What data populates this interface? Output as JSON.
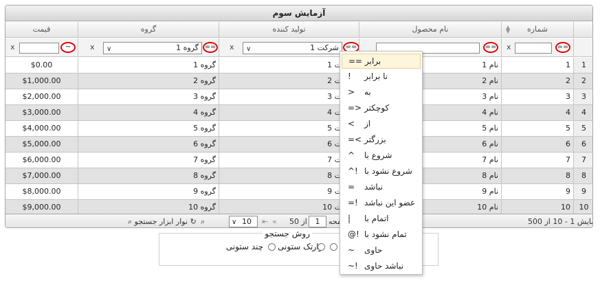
{
  "grid": {
    "caption": "آزمایش سوم",
    "columns": {
      "price": "قیمت",
      "group": "گروه",
      "manufacturer": "تولید کننده",
      "product_name": "نام محصول",
      "number": "شماره"
    },
    "filters": {
      "clear": "x",
      "price_op": "~",
      "group_op": "==",
      "group_value": "گروه 1",
      "manufacturer_op": "==",
      "manufacturer_value": "شرکت 1",
      "product_op": "==",
      "number_op": "=="
    },
    "rows": [
      {
        "price": "$0.00",
        "group": "گروه 1",
        "manufacturer": "شرکت 1",
        "product": "نام 1",
        "number": "1",
        "rownum": "1"
      },
      {
        "price": "$1,000.00",
        "group": "گروه 2",
        "manufacturer": "شرکت 2",
        "product": "نام 2",
        "number": "2",
        "rownum": "2"
      },
      {
        "price": "$2,000.00",
        "group": "گروه 3",
        "manufacturer": "شرکت 3",
        "product": "نام 3",
        "number": "3",
        "rownum": "3"
      },
      {
        "price": "$3,000.00",
        "group": "گروه 4",
        "manufacturer": "شرکت 4",
        "product": "نام 4",
        "number": "4",
        "rownum": "4"
      },
      {
        "price": "$4,000.00",
        "group": "گروه 5",
        "manufacturer": "شرکت 5",
        "product": "نام 5",
        "number": "5",
        "rownum": "5"
      },
      {
        "price": "$5,000.00",
        "group": "گروه 6",
        "manufacturer": "شرکت 6",
        "product": "نام 6",
        "number": "6",
        "rownum": "6"
      },
      {
        "price": "$6,000.00",
        "group": "گروه 7",
        "manufacturer": "شرکت 7",
        "product": "نام 7",
        "number": "7",
        "rownum": "7"
      },
      {
        "price": "$7,000.00",
        "group": "گروه 8",
        "manufacturer": "شرکت 8",
        "product": "نام 8",
        "number": "8",
        "rownum": "8"
      },
      {
        "price": "$8,000.00",
        "group": "گروه 9",
        "manufacturer": "شرکت 9",
        "product": "نام 9",
        "number": "9",
        "rownum": "9"
      },
      {
        "price": "$9,000.00",
        "group": "گروه 10",
        "manufacturer": "شرکت 10",
        "product": "نام 10",
        "number": "10",
        "rownum": "10"
      }
    ]
  },
  "pager": {
    "toolbar_label": "نوار ابزار جستجو",
    "page_size": "10",
    "page_word": "صفحه",
    "page_value": "1",
    "of_total": "از 50",
    "record_info": "نمایش 1 - 10 از 500"
  },
  "search_mode": {
    "title": "روش جستجو",
    "option_toolbar": "نوار",
    "option_single": "تک ستونی",
    "option_multi": "چند ستونی"
  },
  "operator_menu": [
    {
      "symbol": "==",
      "label": "برابر"
    },
    {
      "symbol": "!",
      "label": "نا برابر"
    },
    {
      "symbol": ">",
      "label": "به"
    },
    {
      "symbol": "=>",
      "label": "کوچکتر"
    },
    {
      "symbol": "<",
      "label": "از"
    },
    {
      "symbol": "=<",
      "label": "بزرگتر"
    },
    {
      "symbol": "^",
      "label": "شروع با"
    },
    {
      "symbol": "^!",
      "label": "شروع نشود با"
    },
    {
      "symbol": "=",
      "label": "نباشد"
    },
    {
      "symbol": "=!",
      "label": "عضو این نباشد"
    },
    {
      "symbol": "|",
      "label": "اتمام با"
    },
    {
      "symbol": "@!",
      "label": "تمام نشود با"
    },
    {
      "symbol": "~",
      "label": "حاوی"
    },
    {
      "symbol": "~!",
      "label": "نباشد حاوی"
    }
  ]
}
